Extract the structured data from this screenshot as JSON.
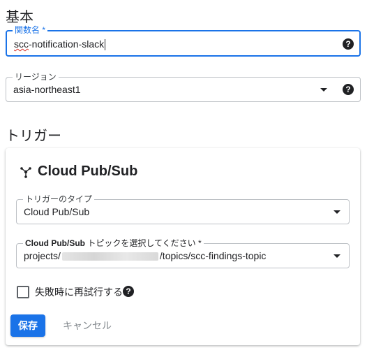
{
  "basic": {
    "heading": "基本",
    "function_name": {
      "label": "関数名 *",
      "value_prefix": "scc",
      "value_rest": "-notification-slack"
    },
    "region": {
      "label": "リージョン",
      "value": "asia-northeast1"
    }
  },
  "trigger": {
    "heading": "トリガー",
    "card_title": "Cloud Pub/Sub",
    "trigger_type": {
      "label": "トリガーのタイプ",
      "value": "Cloud Pub/Sub"
    },
    "topic": {
      "label_bold": "Cloud Pub/Sub",
      "label_rest": " トピックを選択してください *",
      "value_prefix": "projects/",
      "value_suffix": "/topics/scc-findings-topic"
    },
    "retry": {
      "label": "失敗時に再試行する",
      "checked": false
    },
    "buttons": {
      "save": "保存",
      "cancel": "キャンセル"
    }
  },
  "icons": {
    "help": "help-circle-icon",
    "dropdown": "dropdown-arrow-icon",
    "pubsub": "pubsub-icon",
    "checkbox": "checkbox-icon"
  },
  "colors": {
    "accent": "#1a73e8",
    "border": "#bdc1c6",
    "text": "#202124",
    "muted": "#80868b"
  }
}
